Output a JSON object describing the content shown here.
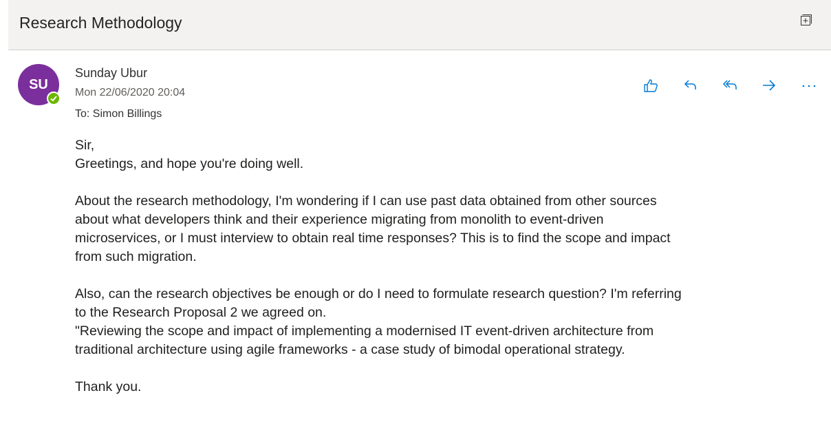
{
  "message": {
    "subject": "Research Methodology",
    "sender": {
      "initials": "SU",
      "name": "Sunday Ubur",
      "date": "Mon 22/06/2020 20:04",
      "presence_color": "#6bb700",
      "avatar_color": "#7b2f9c"
    },
    "to_label": "To:",
    "to_value": "Simon Billings",
    "body": {
      "salutation": "Sir,",
      "greeting": "Greetings,  and hope you're doing well.",
      "para1_line1": "About the research methodology,  I'm wondering if I can use past data obtained from other sources",
      "para1_line2": "about what developers think and their experience migrating from monolith to event-driven",
      "para1_line3": "microservices,  or I must interview to obtain real time responses? This is to find the scope and impact",
      "para1_line4": "from such migration.",
      "para2_line1": "Also, can the research objectives be enough or do I need to formulate research question? I'm referring",
      "para2_line2": "to the Research Proposal 2 we agreed on.",
      "para2_line3": "\"Reviewing the scope and impact of implementing a modernised IT event-driven architecture from",
      "para2_line4": "traditional architecture using agile frameworks - a case study of bimodal operational strategy.",
      "closing": "Thank you."
    }
  },
  "actions": {
    "items": [
      "like-icon",
      "reply-icon",
      "reply-all-icon",
      "forward-icon",
      "more-icon"
    ],
    "accent_color": "#0078d4"
  }
}
